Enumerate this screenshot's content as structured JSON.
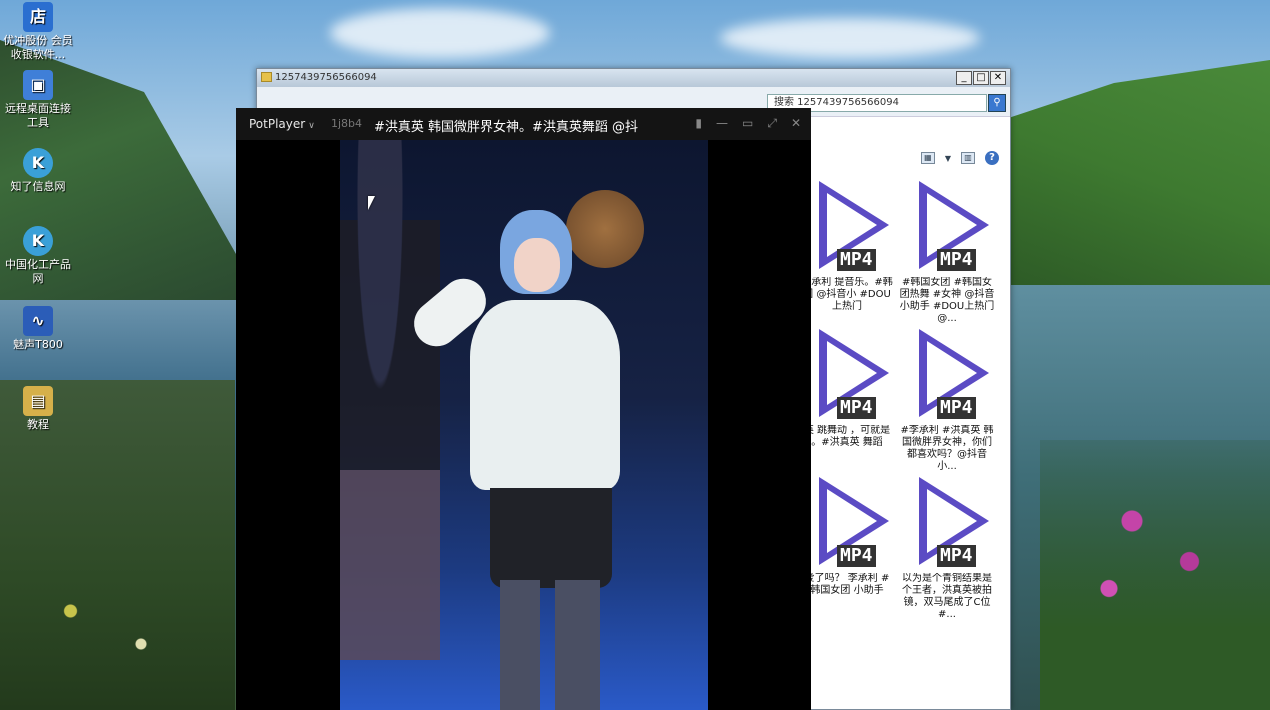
{
  "desktop": {
    "icons": [
      {
        "label": "优冲股份 会员收银软件...",
        "icon": "app-icon",
        "color": "#2a6fd0"
      },
      {
        "label": "远程桌面连接工具",
        "icon": "remote-desktop-icon",
        "color": "#3f7fd8"
      },
      {
        "label": "知了信息网",
        "icon": "k-logo-icon",
        "color": "#3aa0d8"
      },
      {
        "label": "中国化工产品网",
        "icon": "k-logo-icon",
        "color": "#3aa0d8"
      },
      {
        "label": "魅声T800",
        "icon": "audio-wave-icon",
        "color": "#2b5db8"
      },
      {
        "label": "教程",
        "icon": "folder-shortcut-icon",
        "color": "#d6b04a"
      }
    ]
  },
  "explorer": {
    "title": "1257439756566094",
    "search_text": "搜索 1257439756566094",
    "files": [
      {
        "badge": "MP4",
        "name": "李承利 提音乐。#韩 团 @抖音小 #DOU上热门"
      },
      {
        "badge": "MP4",
        "name": "#韩国女团 #韩国女团热舞 #女神 @抖音小助手 #DOU上热门 @..."
      },
      {
        "badge": "MP4",
        "name": "英 跳舞动 ，可就是 。#洪真英 舞蹈"
      },
      {
        "badge": "MP4",
        "name": "#李承利 #洪真英 韩国微胖界女神，你们都喜欢吗？@抖音小..."
      },
      {
        "badge": "MP4",
        "name": "爱了吗？ 李承利 # 韩国女团 小助手"
      },
      {
        "badge": "MP4",
        "name": "以为是个青铜结果是个王者，洪真英被拍镜，双马尾成了C位#..."
      }
    ]
  },
  "player": {
    "app_name": "PotPlayer",
    "dim_text": "1j8b4",
    "title": "#洪真英 韩国微胖界女神。#洪真英舞蹈 @抖",
    "controls": [
      "pin-icon",
      "minimize-icon",
      "maximize-icon",
      "fullscreen-icon",
      "close-icon"
    ]
  }
}
